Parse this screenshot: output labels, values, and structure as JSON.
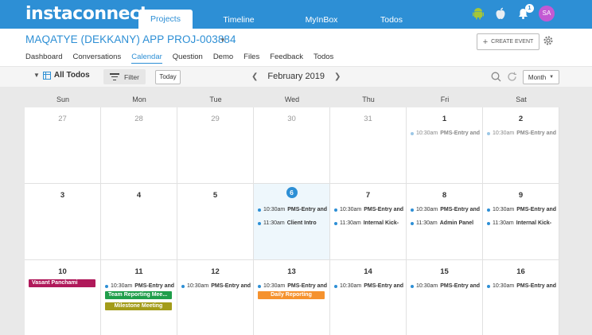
{
  "app": {
    "logo": "instaconnect"
  },
  "topnav": [
    "Projects",
    "Timeline",
    "MyInBox",
    "Todos"
  ],
  "top_icons": {
    "notification_count": "1",
    "avatar_initials": "SA"
  },
  "project": {
    "title": "MAQATYE (DEKKANY) APP PROJ-003884",
    "create_event_label": "CREATE EVENT"
  },
  "subnav": [
    "Dashboard",
    "Conversations",
    "Calendar",
    "Question",
    "Demo",
    "Files",
    "Feedback",
    "Todos"
  ],
  "toolbar": {
    "todos_label": "All Todos",
    "filter_label": "Filter",
    "today_label": "Today",
    "month_label": "February 2019",
    "view_label": "Month"
  },
  "calendar": {
    "dow": [
      "Sun",
      "Mon",
      "Tue",
      "Wed",
      "Thu",
      "Fri",
      "Sat"
    ],
    "weeks": [
      [
        {
          "day": "27",
          "muted": true,
          "events": []
        },
        {
          "day": "28",
          "muted": true,
          "events": []
        },
        {
          "day": "29",
          "muted": true,
          "events": []
        },
        {
          "day": "30",
          "muted": true,
          "events": []
        },
        {
          "day": "31",
          "muted": true,
          "events": []
        },
        {
          "day": "1",
          "muted": false,
          "faded": true,
          "events": [
            {
              "time": "10:30am",
              "name": "PMS-Entry and"
            }
          ]
        },
        {
          "day": "2",
          "muted": false,
          "faded": true,
          "events": [
            {
              "time": "10:30am",
              "name": "PMS-Entry and"
            }
          ]
        }
      ],
      [
        {
          "day": "3",
          "events": []
        },
        {
          "day": "4",
          "events": []
        },
        {
          "day": "5",
          "events": []
        },
        {
          "day": "6",
          "today": true,
          "events": [
            {
              "time": "10:30am",
              "name": "PMS-Entry and"
            },
            {
              "time": "11:30am",
              "name": "Client Intro"
            }
          ]
        },
        {
          "day": "7",
          "events": [
            {
              "time": "10:30am",
              "name": "PMS-Entry and"
            },
            {
              "time": "11:30am",
              "name": "Internal Kick-"
            }
          ]
        },
        {
          "day": "8",
          "events": [
            {
              "time": "10:30am",
              "name": "PMS-Entry and"
            },
            {
              "time": "11:30am",
              "name": "Admin Panel"
            }
          ]
        },
        {
          "day": "9",
          "events": [
            {
              "time": "10:30am",
              "name": "PMS-Entry and"
            },
            {
              "time": "11:30am",
              "name": "Internal Kick-"
            }
          ]
        }
      ],
      [
        {
          "day": "10",
          "bars": [
            {
              "label": "Vasant Panchami",
              "color": "#b0195a"
            }
          ],
          "events": []
        },
        {
          "day": "11",
          "events": [
            {
              "time": "10:30am",
              "name": "PMS-Entry and"
            }
          ],
          "bars": [
            {
              "label": "Team Reporting Mee...",
              "color": "#1f9e4a"
            },
            {
              "label": "Milestone Meeting",
              "color": "#a39c1a",
              "centered": true
            }
          ]
        },
        {
          "day": "12",
          "events": [
            {
              "time": "10:30am",
              "name": "PMS-Entry and"
            }
          ]
        },
        {
          "day": "13",
          "events": [
            {
              "time": "10:30am",
              "name": "PMS-Entry and"
            }
          ],
          "bars": [
            {
              "label": "Daily Reporting",
              "color": "#f5922e",
              "centered": true
            }
          ]
        },
        {
          "day": "14",
          "events": [
            {
              "time": "10:30am",
              "name": "PMS-Entry and"
            }
          ]
        },
        {
          "day": "15",
          "events": [
            {
              "time": "10:30am",
              "name": "PMS-Entry and"
            }
          ]
        },
        {
          "day": "16",
          "events": [
            {
              "time": "10:30am",
              "name": "PMS-Entry and"
            }
          ]
        }
      ]
    ]
  },
  "colors": {
    "brand": "#2d8fd5",
    "avatar": "#c35ad3"
  }
}
